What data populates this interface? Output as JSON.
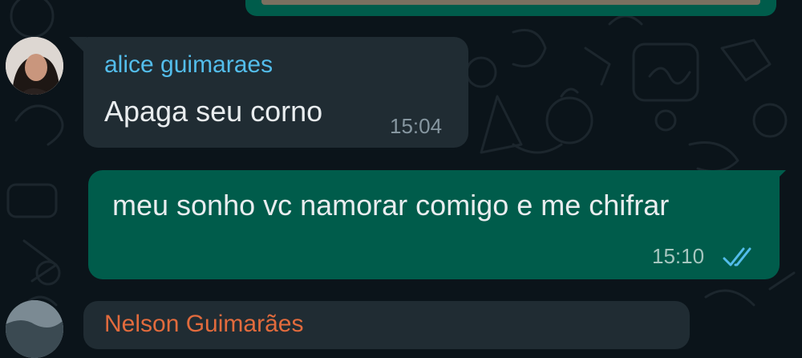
{
  "messages": [
    {
      "direction": "incoming",
      "sender": "alice guimaraes",
      "sender_color": "#53bdeb",
      "text": "Apaga seu corno",
      "time": "15:04"
    },
    {
      "direction": "outgoing",
      "text": "meu sonho vc namorar comigo e me chifrar",
      "time": "15:10",
      "status_icon": "double-check-read-icon",
      "status_color": "#53bdeb"
    },
    {
      "direction": "incoming",
      "sender": "Nelson Guimarães",
      "sender_color": "#e26b3d"
    }
  ],
  "theme": {
    "background": "#0b141a",
    "incoming_bubble": "#202c33",
    "outgoing_bubble": "#005c4b"
  }
}
